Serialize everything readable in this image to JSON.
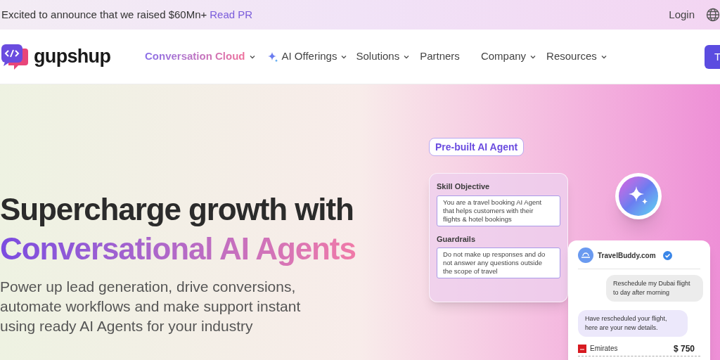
{
  "announcement": {
    "text": "Excited to announce that we raised $60Mn+",
    "link": "Read PR",
    "login": "Login"
  },
  "nav": {
    "logo": "gupshup",
    "items": [
      {
        "label": "Conversation Cloud",
        "dropdown": true,
        "selected": true,
        "sparkle": false
      },
      {
        "label": "AI Offerings",
        "dropdown": true,
        "selected": false,
        "sparkle": true
      },
      {
        "label": "Solutions",
        "dropdown": true,
        "selected": false,
        "sparkle": false
      },
      {
        "label": "Partners",
        "dropdown": false,
        "selected": false,
        "sparkle": false
      },
      {
        "label": "Company",
        "dropdown": true,
        "selected": false,
        "sparkle": false
      },
      {
        "label": "Resources",
        "dropdown": true,
        "selected": false,
        "sparkle": false
      }
    ],
    "cta": "T"
  },
  "hero": {
    "headline": "Supercharge growth with",
    "highlight": "Conversational AI Agents",
    "subtitle": "Power up lead generation, drive conversions, automate workflows and make support instant using ready AI Agents for your industry"
  },
  "agent_card": {
    "badge": "Pre-built AI Agent",
    "sections": [
      {
        "title": "Skill Objective",
        "text": "You are a travel booking AI Agent that helps customers with their flights & hotel bookings"
      },
      {
        "title": "Guardrails",
        "text": "Do not make up responses and do not answer any questions outside the scope of travel"
      }
    ]
  },
  "chat": {
    "name": "TravelBuddy.com",
    "verified": true,
    "messages": [
      {
        "kind": "sent",
        "text": "Reschedule my Dubai flight to day after morning"
      },
      {
        "kind": "received",
        "text": "Have rescheduled your flight, here are your new details."
      }
    ],
    "flight": {
      "airline": "Emirates",
      "price": "$ 750"
    }
  }
}
